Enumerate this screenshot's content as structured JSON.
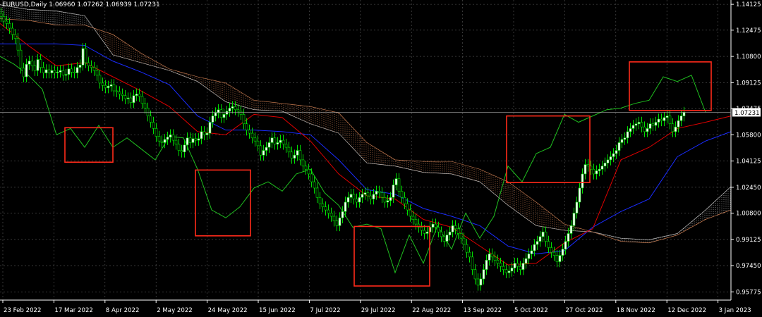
{
  "window": {
    "title": "EURUSD,Daily  1.06960 1.07262 1.06939 1.07231"
  },
  "colors": {
    "background": "#000000",
    "grid": "#5a5a5a",
    "bull": "#ffffff",
    "bear": "#ffffff",
    "candle_wick": "#00e000",
    "tenkan": "#e00000",
    "kijun": "#1a2cff",
    "chikou": "#1fbf1f",
    "cloud_bull": "#d0d0d0",
    "cloud_bear": "#e08a5a",
    "highlight_box": "#ff2a1a",
    "axis_text": "#ffffff",
    "price_tag_bg": "#ffffff",
    "price_tag_fg": "#000000"
  },
  "chart_data": {
    "type": "line",
    "title": "EURUSD,Daily  1.06960 1.07262 1.06939 1.07231",
    "indicator": "Ichimoku Kinko Hyo",
    "x_tick_labels": [
      "23 Feb 2022",
      "17 Mar 2022",
      "8 Apr 2022",
      "2 May 2022",
      "24 May 2022",
      "15 Jun 2022",
      "7 Jul 2022",
      "29 Jul 2022",
      "22 Aug 2022",
      "13 Sep 2022",
      "5 Oct 2022",
      "27 Oct 2022",
      "18 Nov 2022",
      "12 Dec 2022",
      "3 Jan 2023"
    ],
    "y_tick_labels": [
      "1.14125",
      "1.12475",
      "1.10800",
      "1.09125",
      "1.07475",
      "1.05800",
      "1.04125",
      "1.02450",
      "1.00800",
      "0.99125",
      "0.97450",
      "0.95775"
    ],
    "ylim": [
      0.9525,
      1.144
    ],
    "current_price": "1.07231",
    "ohlc_last": {
      "open": 1.0696,
      "high": 1.07262,
      "low": 1.06939,
      "close": 1.07231
    },
    "grid": true,
    "series": [
      {
        "type": "candles",
        "x": [
          0,
          4,
          8,
          12,
          16,
          20,
          24,
          28,
          32,
          36,
          40,
          44,
          48,
          52,
          56,
          60,
          64,
          68,
          72,
          76,
          80,
          84,
          88,
          92,
          96,
          100,
          104,
          108,
          112,
          116,
          120,
          124,
          128,
          132,
          136,
          140,
          144,
          148,
          152,
          156,
          160,
          164,
          168,
          172,
          176,
          180,
          184,
          188,
          192,
          196,
          200,
          204,
          208,
          212,
          216,
          220,
          224,
          228,
          232,
          236,
          240,
          244,
          248,
          252,
          256,
          260,
          264,
          268,
          272,
          276,
          280,
          284,
          288,
          292,
          296,
          300,
          304,
          308,
          312,
          316,
          320,
          324,
          328,
          332,
          336,
          340,
          344,
          348,
          352,
          356,
          360,
          364,
          368,
          372,
          376,
          380,
          384,
          388,
          392,
          396,
          400,
          404,
          408,
          412,
          416,
          420,
          424,
          428,
          432,
          436,
          440,
          444,
          448,
          452,
          456,
          460,
          464,
          468,
          472,
          476,
          480,
          484,
          488,
          492,
          496,
          500,
          504,
          508,
          512,
          516,
          520,
          524,
          528,
          532,
          536,
          540,
          544,
          548,
          552,
          556,
          560,
          564,
          568,
          572,
          576,
          580,
          584,
          588,
          592,
          596,
          600,
          604,
          608,
          612,
          616,
          620,
          624,
          628,
          632,
          636,
          640,
          644,
          648,
          652,
          656,
          660,
          664,
          668,
          672,
          676,
          680,
          684,
          688,
          692,
          696,
          700,
          704,
          708,
          712,
          716,
          720,
          724,
          728,
          732,
          736,
          740,
          744,
          748,
          752,
          756,
          760,
          764,
          768,
          772,
          776,
          780,
          784,
          788,
          792,
          796,
          800,
          804,
          808,
          812,
          816,
          820,
          824,
          828,
          832,
          836,
          840,
          844,
          848,
          852,
          856,
          860,
          864,
          868,
          872,
          876,
          880,
          884,
          888,
          892,
          896,
          900,
          904,
          908,
          912,
          916,
          920,
          924,
          928,
          932,
          936,
          940,
          944,
          948,
          952,
          956,
          960,
          964,
          968,
          972,
          976,
          980,
          984,
          988,
          992,
          996,
          1000,
          1004,
          1008,
          1012,
          1016,
          1020,
          1024,
          1028,
          1032,
          1036
        ],
        "close": [
          1.1335,
          1.1305,
          1.129,
          1.126,
          1.122,
          1.1195,
          1.112,
          1.1005,
          1.095,
          1.103,
          1.105,
          1.102,
          1.099,
          1.106,
          1.101,
          1.0975,
          1.0995,
          1.0975,
          1.099,
          1.0975,
          1.098,
          1.099,
          1.096,
          1.0965,
          1.1,
          1.098,
          1.0975,
          1.101,
          1.1025,
          1.113,
          1.104,
          1.102,
          1.101,
          1.099,
          1.096,
          1.091,
          1.0895,
          1.088,
          1.089,
          1.09,
          1.086,
          1.0855,
          1.084,
          1.083,
          1.081,
          1.0815,
          1.0785,
          1.083,
          1.084,
          1.0825,
          1.078,
          1.075,
          1.07,
          1.066,
          1.062,
          1.057,
          1.054,
          1.053,
          1.055,
          1.0565,
          1.058,
          1.0545,
          1.052,
          1.048,
          1.047,
          1.0515,
          1.056,
          1.053,
          1.0555,
          1.0545,
          1.0555,
          1.06,
          1.058,
          1.059,
          1.066,
          1.07,
          1.072,
          1.074,
          1.069,
          1.071,
          1.073,
          1.075,
          1.076,
          1.074,
          1.073,
          1.071,
          1.065,
          1.061,
          1.059,
          1.056,
          1.054,
          1.051,
          1.045,
          1.048,
          1.05,
          1.053,
          1.056,
          1.052,
          1.053,
          1.0545,
          1.052,
          1.05,
          1.047,
          1.043,
          1.045,
          1.048,
          1.042,
          1.038,
          1.036,
          1.033,
          1.028,
          1.024,
          1.018,
          1.014,
          1.012,
          1.01,
          1.008,
          1.006,
          1.003,
          1.0,
          1.005,
          1.009,
          1.015,
          1.018,
          1.02,
          1.017,
          1.015,
          1.018,
          1.02,
          1.021,
          1.019,
          1.017,
          1.02,
          1.022,
          1.021,
          1.018,
          1.015,
          1.016,
          1.018,
          1.026,
          1.03,
          1.022,
          1.018,
          1.014,
          1.01,
          1.006,
          1.004,
          1.001,
          0.999,
          0.997,
          0.995,
          0.996,
          0.999,
          1.001,
          0.999,
          0.996,
          0.993,
          0.99,
          0.994,
          0.996,
          1.0,
          0.998,
          0.995,
          0.992,
          0.988,
          0.983,
          0.98,
          0.972,
          0.966,
          0.962,
          0.966,
          0.972,
          0.978,
          0.982,
          0.98,
          0.978,
          0.976,
          0.974,
          0.972,
          0.97,
          0.971,
          0.973,
          0.976,
          0.974,
          0.972,
          0.976,
          0.979,
          0.982,
          0.984,
          0.988,
          0.99,
          0.993,
          0.996,
          0.99,
          0.986,
          0.983,
          0.981,
          0.977,
          0.981,
          0.985,
          0.99,
          0.995,
          1.0,
          1.008,
          1.015,
          1.024,
          1.033,
          1.039,
          1.038,
          1.036,
          1.033,
          1.035,
          1.036,
          1.038,
          1.04,
          1.042,
          1.044,
          1.046,
          1.048,
          1.053,
          1.055,
          1.056,
          1.06,
          1.062,
          1.064,
          1.065,
          1.066,
          1.063,
          1.06,
          1.062,
          1.065,
          1.064,
          1.066,
          1.068,
          1.067,
          1.069,
          1.07,
          1.065,
          1.06,
          1.063,
          1.067,
          1.07,
          1.0723
        ]
      },
      {
        "name": "",
        "role": "tenkan",
        "x": [
          0,
          40,
          80,
          120,
          160,
          200,
          240,
          280,
          320,
          360,
          400,
          440,
          480,
          520,
          560,
          600,
          640,
          680,
          720,
          760,
          800,
          840,
          880,
          920,
          960,
          1000,
          1036
        ],
        "y": [
          1.129,
          1.115,
          1.102,
          1.104,
          1.095,
          1.086,
          1.076,
          1.06,
          1.058,
          1.071,
          1.069,
          1.054,
          1.033,
          1.019,
          1.017,
          1.004,
          0.999,
          0.987,
          0.975,
          0.976,
          0.989,
          0.998,
          1.042,
          1.05,
          1.062,
          1.066,
          1.07
        ]
      },
      {
        "name": "",
        "role": "kijun",
        "x": [
          0,
          40,
          80,
          120,
          160,
          200,
          240,
          280,
          320,
          360,
          400,
          440,
          480,
          520,
          560,
          600,
          640,
          680,
          720,
          760,
          800,
          840,
          880,
          920,
          960,
          1000,
          1036
        ],
        "y": [
          1.116,
          1.116,
          1.116,
          1.115,
          1.105,
          1.098,
          1.09,
          1.07,
          1.061,
          1.061,
          1.06,
          1.058,
          1.042,
          1.023,
          1.02,
          1.011,
          1.006,
          1.0,
          0.987,
          0.982,
          0.984,
          0.999,
          1.009,
          1.017,
          1.044,
          1.054,
          1.06
        ]
      },
      {
        "name": "",
        "role": "chikou",
        "x": [
          0,
          20,
          40,
          60,
          80,
          100,
          120,
          140,
          160,
          180,
          200,
          220,
          240,
          260,
          280,
          300,
          320,
          340,
          360,
          380,
          400,
          420,
          440,
          460,
          480,
          500,
          520,
          540,
          560,
          580,
          600,
          620,
          640,
          660,
          680,
          700,
          720,
          740,
          760,
          780,
          800,
          820,
          840,
          860,
          880,
          900,
          920,
          940,
          960,
          980,
          1000
        ],
        "y": [
          1.108,
          1.103,
          1.096,
          1.087,
          1.058,
          1.062,
          1.05,
          1.064,
          1.05,
          1.056,
          1.049,
          1.042,
          1.057,
          1.056,
          1.036,
          1.01,
          1.005,
          1.012,
          1.024,
          1.028,
          1.022,
          1.033,
          1.036,
          1.021,
          1.013,
          0.999,
          1.001,
          0.998,
          0.97,
          0.994,
          0.976,
          1.0,
          0.985,
          1.008,
          0.992,
          1.006,
          1.038,
          1.028,
          1.046,
          1.05,
          1.071,
          1.066,
          1.07,
          1.074,
          1.075,
          1.078,
          1.08,
          1.095,
          1.092,
          1.096,
          1.0723
        ]
      },
      {
        "name": "",
        "role": "senkou_a",
        "x": [
          0,
          40,
          80,
          120,
          160,
          200,
          240,
          280,
          320,
          360,
          400,
          440,
          480,
          520,
          560,
          600,
          640,
          680,
          720,
          760,
          800,
          840,
          880,
          920,
          960,
          1000,
          1036
        ],
        "y": [
          1.141,
          1.138,
          1.137,
          1.134,
          1.109,
          1.104,
          1.099,
          1.092,
          1.079,
          1.074,
          1.073,
          1.065,
          1.059,
          1.04,
          1.038,
          1.034,
          1.033,
          1.028,
          1.013,
          1.0,
          0.997,
          0.996,
          0.992,
          0.991,
          0.995,
          1.01,
          1.025
        ]
      },
      {
        "name": "",
        "role": "senkou_b",
        "x": [
          0,
          40,
          80,
          120,
          160,
          200,
          240,
          280,
          320,
          360,
          400,
          440,
          480,
          520,
          560,
          600,
          640,
          680,
          720,
          760,
          800,
          840,
          880,
          920,
          960,
          1000,
          1036
        ],
        "y": [
          1.132,
          1.131,
          1.128,
          1.128,
          1.122,
          1.11,
          1.1,
          1.095,
          1.091,
          1.08,
          1.078,
          1.076,
          1.072,
          1.053,
          1.042,
          1.041,
          1.041,
          1.036,
          1.028,
          1.015,
          1.001,
          0.996,
          0.99,
          0.989,
          0.994,
          1.004,
          1.01
        ]
      }
    ],
    "annotations": [
      {
        "type": "rectangle",
        "x0": 92,
        "x1": 160,
        "y0": 1.0405,
        "y1": 1.0625
      },
      {
        "type": "rectangle",
        "x0": 277,
        "x1": 355,
        "y0": 0.9935,
        "y1": 1.0355
      },
      {
        "type": "rectangle",
        "x0": 502,
        "x1": 609,
        "y0": 0.9615,
        "y1": 0.9995
      },
      {
        "type": "rectangle",
        "x0": 718,
        "x1": 836,
        "y0": 1.0275,
        "y1": 1.07
      },
      {
        "type": "rectangle",
        "x0": 892,
        "x1": 1008,
        "y0": 1.0735,
        "y1": 1.1045
      }
    ]
  }
}
